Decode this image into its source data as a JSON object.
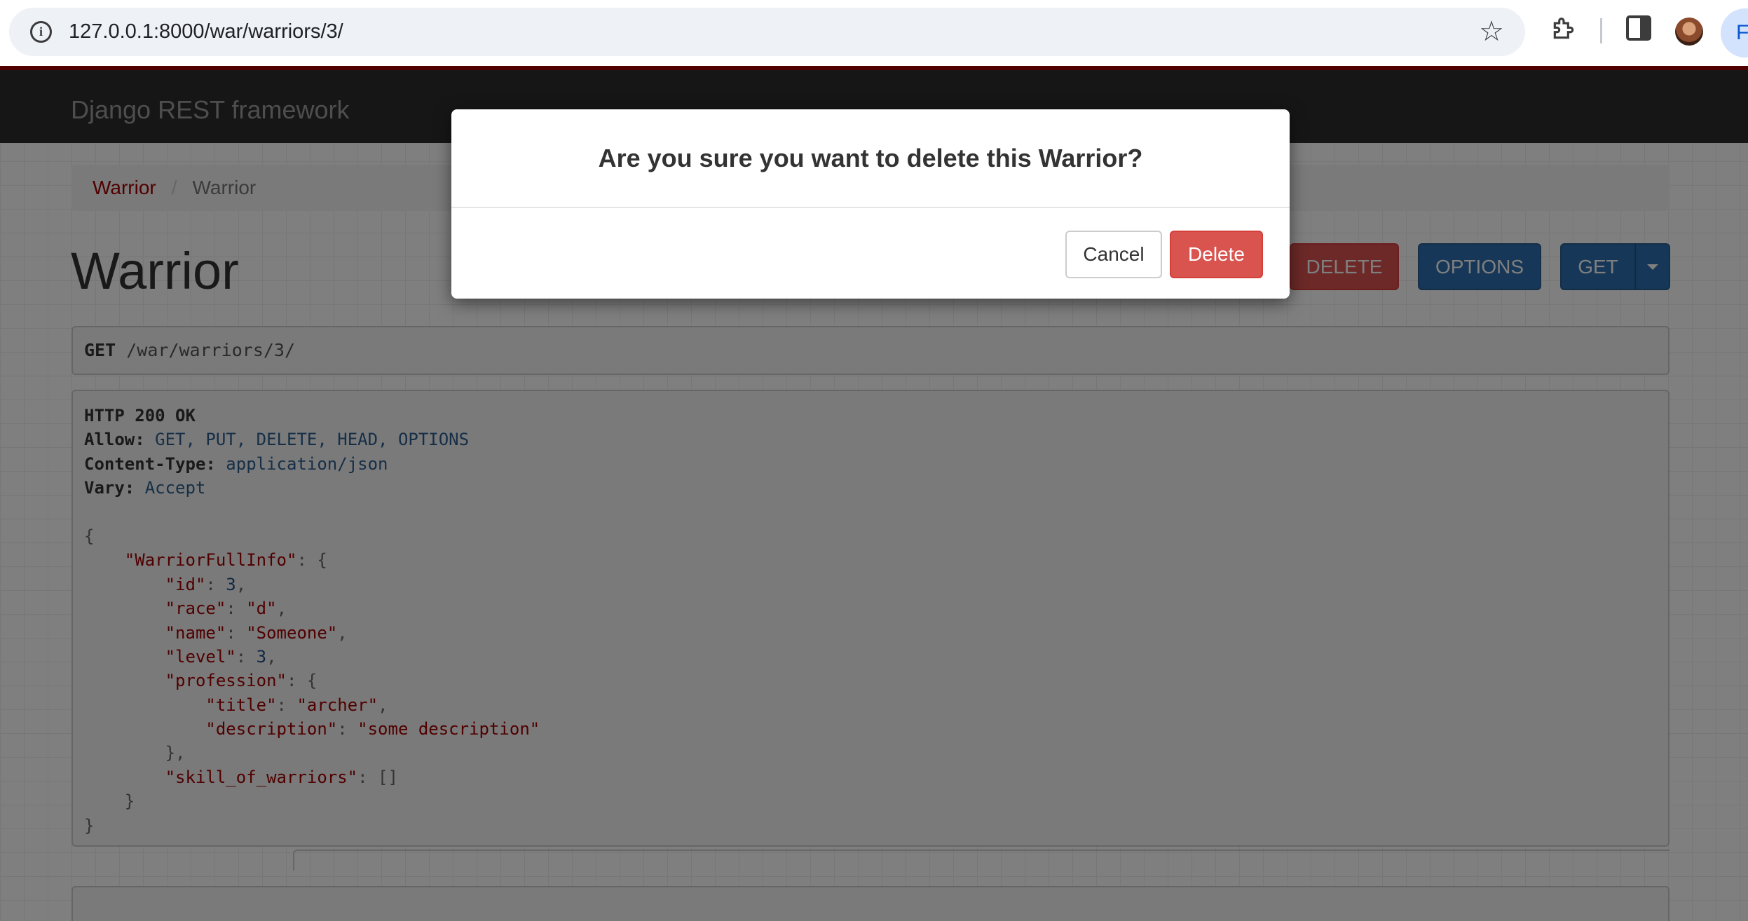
{
  "browser": {
    "url": "127.0.0.1:8000/war/warriors/3/",
    "profile_initial": "F"
  },
  "navbar": {
    "brand": "Django REST framework"
  },
  "breadcrumb": {
    "link": "Warrior",
    "separator": "/",
    "active": "Warrior"
  },
  "page": {
    "title": "Warrior"
  },
  "actions": {
    "delete": "DELETE",
    "options": "OPTIONS",
    "get": "GET"
  },
  "request": {
    "method": "GET",
    "path": "/war/warriors/3/"
  },
  "response": {
    "status": "HTTP 200 OK",
    "headers": [
      {
        "key": "Allow:",
        "value": "GET, PUT, DELETE, HEAD, OPTIONS"
      },
      {
        "key": "Content-Type:",
        "value": "application/json"
      },
      {
        "key": "Vary:",
        "value": "Accept"
      }
    ],
    "body": {
      "root_key": "\"WarriorFullInfo\"",
      "id_key": "\"id\"",
      "id_val": "3",
      "race_key": "\"race\"",
      "race_val": "\"d\"",
      "name_key": "\"name\"",
      "name_val": "\"Someone\"",
      "level_key": "\"level\"",
      "level_val": "3",
      "profession_key": "\"profession\"",
      "title_key": "\"title\"",
      "title_val": "\"archer\"",
      "description_key": "\"description\"",
      "description_val": "\"some description\"",
      "skills_key": "\"skill_of_warriors\"",
      "skills_val": "[]"
    }
  },
  "modal": {
    "title": "Are you sure you want to delete this Warrior?",
    "cancel": "Cancel",
    "delete": "Delete"
  },
  "colors": {
    "brand_red": "#a30000",
    "danger": "#d9534f",
    "primary": "#2c6fae"
  }
}
